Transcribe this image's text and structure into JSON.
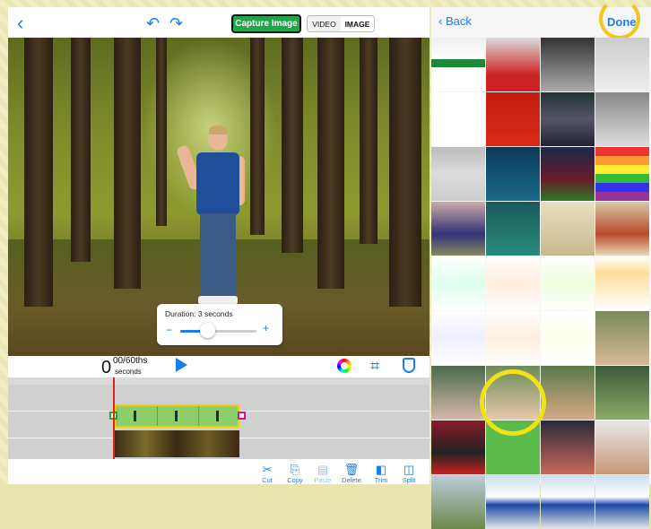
{
  "header": {
    "capture_label": "Capture Image",
    "mode_video": "VIDEO",
    "mode_image": "IMAGE",
    "back_icon": "chevron-left-icon",
    "undo_icon": "undo-icon",
    "redo_icon": "redo-icon"
  },
  "duration": {
    "label": "Duration: 3 seconds",
    "minus": "−",
    "plus": "+",
    "slider_level": 0.35
  },
  "timecode": {
    "big": "0",
    "fraction": "00/60ths",
    "unit": "seconds"
  },
  "tools": [
    {
      "label": "Cut",
      "icon": "scissors-icon",
      "enabled": true
    },
    {
      "label": "Copy",
      "icon": "copy-icon",
      "enabled": true
    },
    {
      "label": "Paste",
      "icon": "paste-icon",
      "enabled": false
    },
    {
      "label": "Delete",
      "icon": "trash-icon",
      "enabled": true
    },
    {
      "label": "Trim",
      "icon": "trim-icon",
      "enabled": true
    },
    {
      "label": "Split",
      "icon": "split-icon",
      "enabled": true
    }
  ],
  "photos_panel": {
    "back_label": "Back",
    "done_label": "Done"
  },
  "colors": {
    "accent": "#1a7ef0",
    "capture_green": "#1ea64a",
    "highlight_yellow": "#f0e218"
  }
}
